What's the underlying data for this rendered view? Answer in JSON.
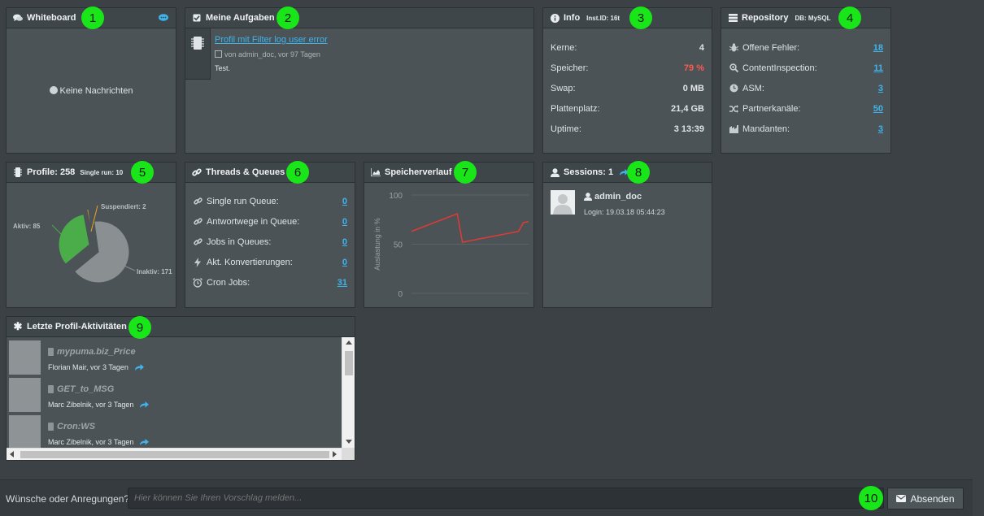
{
  "whiteboard": {
    "title": "Whiteboard",
    "empty": "Keine Nachrichten"
  },
  "tasks": {
    "title": "Meine Aufgaben",
    "item": {
      "link": "Profil mit Filter log user error",
      "meta": "von admin_doc, vor 97 Tagen",
      "desc": "Test."
    }
  },
  "info": {
    "title": "Info",
    "sub": "Inst.ID: 16t",
    "rows": [
      {
        "label": "Kerne:",
        "value": "4"
      },
      {
        "label": "Speicher:",
        "value": "79 %"
      },
      {
        "label": "Swap:",
        "value": "0 MB"
      },
      {
        "label": "Plattenplatz:",
        "value": "21,4 GB"
      },
      {
        "label": "Uptime:",
        "value": "3 13:39"
      }
    ]
  },
  "repository": {
    "title": "Repository",
    "sub": "DB: MySQL",
    "rows": [
      {
        "label": "Offene Fehler:",
        "value": "18",
        "icon": "bug-icon"
      },
      {
        "label": "ContentInspection:",
        "value": "11",
        "icon": "magnifier-icon"
      },
      {
        "label": "ASM:",
        "value": "3",
        "icon": "clock-icon"
      },
      {
        "label": "Partnerkanäle:",
        "value": "50",
        "icon": "shuffle-icon"
      },
      {
        "label": "Mandanten:",
        "value": "3",
        "icon": "buildings-icon"
      }
    ]
  },
  "profile": {
    "title": "Profile: 258",
    "sub": "Single run: 10",
    "chart_data": {
      "type": "pie",
      "slices": [
        {
          "label": "Aktiv: 85",
          "value": 85,
          "color": "#4aad4a"
        },
        {
          "label": "Suspendiert: 2",
          "value": 2,
          "color": "#f0a020"
        },
        {
          "label": "Inaktiv: 171",
          "value": 171,
          "color": "#8a8f92"
        }
      ]
    }
  },
  "threads": {
    "title": "Threads & Queues",
    "rows": [
      {
        "label": "Single run Queue:",
        "value": "0",
        "icon": "link-icon"
      },
      {
        "label": "Antwortwege in Queue:",
        "value": "0",
        "icon": "link-icon"
      },
      {
        "label": "Jobs in Queues:",
        "value": "0",
        "icon": "link-icon"
      },
      {
        "label": "Akt. Konvertierungen:",
        "value": "0",
        "icon": "bolt-icon"
      },
      {
        "label": "Cron Jobs:",
        "value": "31",
        "icon": "alarm-icon"
      }
    ]
  },
  "memory": {
    "title": "Speicherverlauf",
    "chart_data": {
      "type": "line",
      "ylabel": "Auslastung in %",
      "ylim": [
        0,
        100
      ],
      "yticks": [
        "100",
        "50",
        "0"
      ],
      "series": [
        {
          "color": "#e23a34",
          "x": [
            0,
            1,
            2,
            3,
            4,
            5,
            6,
            7,
            8,
            9,
            10,
            11,
            12,
            13,
            14,
            15,
            16,
            17,
            18,
            19,
            20,
            21,
            22,
            23
          ],
          "y": [
            63,
            65,
            67,
            69,
            71,
            73,
            75,
            77,
            79,
            81,
            52,
            53,
            54,
            55,
            56,
            57,
            58,
            59,
            60,
            61,
            62,
            63,
            72,
            73
          ]
        }
      ]
    }
  },
  "sessions": {
    "title": "Sessions: 1",
    "user": {
      "name": "admin_doc",
      "login": "Login: 19.03.18 05:44:23"
    }
  },
  "activities": {
    "title": "Letzte Profil-Aktivitäten",
    "items": [
      {
        "name": "mypuma.biz_Price",
        "meta": "Florian Mair, vor 3 Tagen"
      },
      {
        "name": "GET_to_MSG",
        "meta": "Marc Zibelnik, vor 3 Tagen"
      },
      {
        "name": "Cron:WS",
        "meta": "Marc Zibelnik, vor 3 Tagen"
      }
    ]
  },
  "feedback": {
    "label": "Wünsche oder Anregungen?",
    "placeholder": "Hier können Sie Ihren Vorschlag melden...",
    "button": "Absenden"
  },
  "badges": [
    "1",
    "2",
    "3",
    "4",
    "5",
    "6",
    "7",
    "8",
    "9",
    "10"
  ]
}
